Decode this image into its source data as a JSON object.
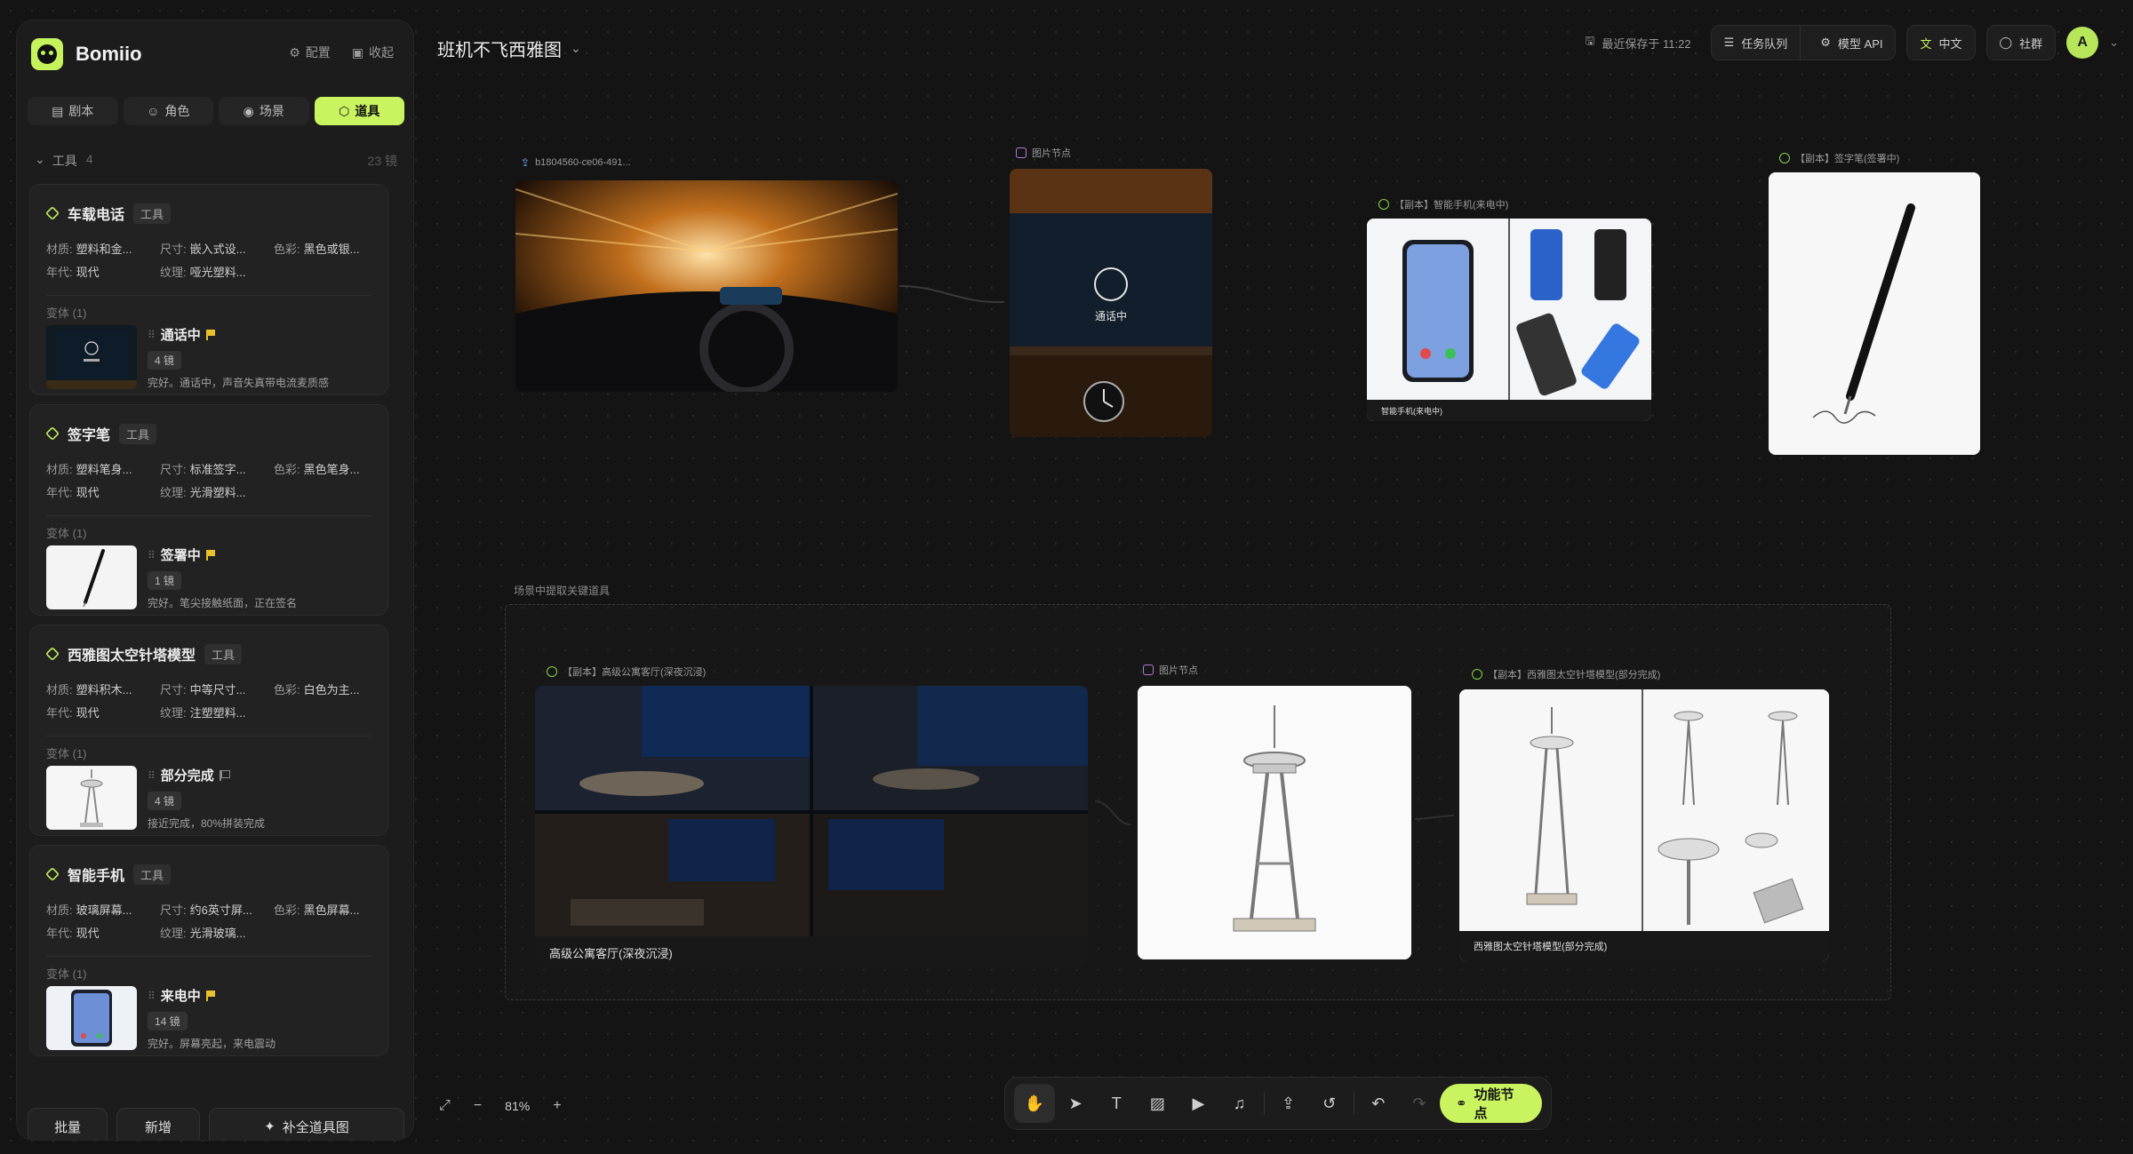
{
  "app": {
    "name": "Bomiio"
  },
  "sidebar": {
    "actions": {
      "config": "配置",
      "collapse": "收起"
    },
    "tabs": [
      {
        "label": "剧本",
        "icon": "script-icon"
      },
      {
        "label": "角色",
        "icon": "users-icon"
      },
      {
        "label": "场景",
        "icon": "location-pin-icon"
      },
      {
        "label": "道具",
        "icon": "box-icon",
        "active": true
      }
    ],
    "list_header": {
      "title": "工具",
      "count": "4",
      "right": "23 镜"
    },
    "variant_heading": "变体 (1)",
    "items": [
      {
        "name": "车载电话",
        "tag": "工具",
        "attrs": [
          [
            "材质:",
            "塑料和金..."
          ],
          [
            "尺寸:",
            "嵌入式设..."
          ],
          [
            "色彩:",
            "黑色或银..."
          ],
          [
            "年代:",
            "现代"
          ],
          [
            "纹理:",
            "哑光塑料..."
          ]
        ],
        "variant": {
          "name": "通话中",
          "shots": "4 镜",
          "desc": "完好。通话中，声音失真带电流麦质感",
          "flag": "yellow"
        }
      },
      {
        "name": "签字笔",
        "tag": "工具",
        "attrs": [
          [
            "材质:",
            "塑料笔身..."
          ],
          [
            "尺寸:",
            "标准签字..."
          ],
          [
            "色彩:",
            "黑色笔身..."
          ],
          [
            "年代:",
            "现代"
          ],
          [
            "纹理:",
            "光滑塑料..."
          ]
        ],
        "variant": {
          "name": "签署中",
          "shots": "1 镜",
          "desc": "完好。笔尖接触纸面，正在签名",
          "flag": "yellow"
        }
      },
      {
        "name": "西雅图太空针塔模型",
        "tag": "工具",
        "attrs": [
          [
            "材质:",
            "塑料积木..."
          ],
          [
            "尺寸:",
            "中等尺寸..."
          ],
          [
            "色彩:",
            "白色为主..."
          ],
          [
            "年代:",
            "现代"
          ],
          [
            "纹理:",
            "注塑塑料..."
          ]
        ],
        "variant": {
          "name": "部分完成",
          "shots": "4 镜",
          "desc": "接近完成，80%拼装完成",
          "flag": "outline"
        }
      },
      {
        "name": "智能手机",
        "tag": "工具",
        "attrs": [
          [
            "材质:",
            "玻璃屏幕..."
          ],
          [
            "尺寸:",
            "约6英寸屏..."
          ],
          [
            "色彩:",
            "黑色屏幕..."
          ],
          [
            "年代:",
            "现代"
          ],
          [
            "纹理:",
            "光滑玻璃..."
          ]
        ],
        "variant": {
          "name": "来电中",
          "shots": "14 镜",
          "desc": "完好。屏幕亮起，来电震动",
          "flag": "yellow"
        }
      }
    ],
    "bottom": {
      "batch": "批量",
      "add": "新增",
      "complete": "补全道具图"
    }
  },
  "header": {
    "project_title": "班机不飞西雅图",
    "saved": "最近保存于 11:22",
    "task_queue": "任务队列",
    "model_api": "模型 API",
    "language": "中文",
    "community": "社群",
    "avatar": "A"
  },
  "canvas": {
    "nodes": {
      "upload": "b1804560-ce06-491...",
      "image_node_1": "图片节点",
      "phone_node": "【副本】智能手机(来电中)",
      "phone_caption": "智能手机(来电中)",
      "pen_node": "【副本】签字笔(签署中)",
      "call_text": "通话中",
      "group_title": "场景中提取关键道具",
      "apartment_node": "【副本】高级公寓客厅(深夜沉浸)",
      "apartment_caption": "高级公寓客厅(深夜沉浸)",
      "image_node_2": "图片节点",
      "tower_node": "【副本】西雅图太空针塔模型(部分完成)",
      "tower_caption": "西雅图太空针塔模型(部分完成)"
    }
  },
  "toolbar": {
    "function_node": "功能节点",
    "zoom": "81%"
  },
  "colors": {
    "accent": "#c9f35f",
    "flag": "#e8c12c",
    "background": "#141414"
  }
}
